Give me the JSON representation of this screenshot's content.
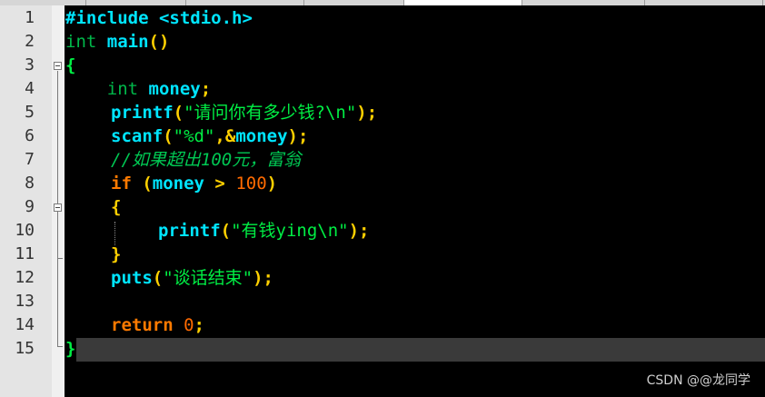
{
  "editor": {
    "line_numbers": [
      "1",
      "2",
      "3",
      "4",
      "5",
      "6",
      "7",
      "8",
      "9",
      "10",
      "11",
      "12",
      "13",
      "14",
      "15"
    ],
    "code": {
      "l1_include": "#include <stdio.h>",
      "l2_int": "int",
      "l2_main": " main",
      "l2_parens": "()",
      "l3_brace": "{",
      "l4_indent": "    ",
      "l4_int": "int",
      "l4_var": " money",
      "l4_semi": ";",
      "l5_fn": "printf",
      "l5_open": "(",
      "l5_str": "\"请问你有多少钱?\\n\"",
      "l5_close": ");",
      "l6_fn": "scanf",
      "l6_open": "(",
      "l6_str": "\"%d\"",
      "l6_comma": ",",
      "l6_amp": "&",
      "l6_var": "money",
      "l6_close": ");",
      "l7_comment": "//如果超出100元，富翁",
      "l8_kw": "if",
      "l8_open": " (",
      "l8_var": "money",
      "l8_op": " >",
      "l8_num": " 100",
      "l8_close": ")",
      "l9_brace": "{",
      "l10_fn": "printf",
      "l10_open": "(",
      "l10_str": "\"有钱ying\\n\"",
      "l10_close": ");",
      "l11_brace": "}",
      "l12_fn": "puts",
      "l12_open": "(",
      "l12_str": "\"谈话结束\"",
      "l12_close": ");",
      "l14_kw": "return",
      "l14_num": " 0",
      "l14_semi": ";",
      "l15_brace": "}"
    }
  },
  "watermark": "CSDN @@龙同学",
  "colors": {
    "background": "#000000",
    "gutter": "#e4e4e4",
    "current_line": "#3a3a3a",
    "string": "#00ee44",
    "function": "#00e5ff",
    "keyword": "#ff7a00",
    "punctuation": "#ffd000"
  }
}
